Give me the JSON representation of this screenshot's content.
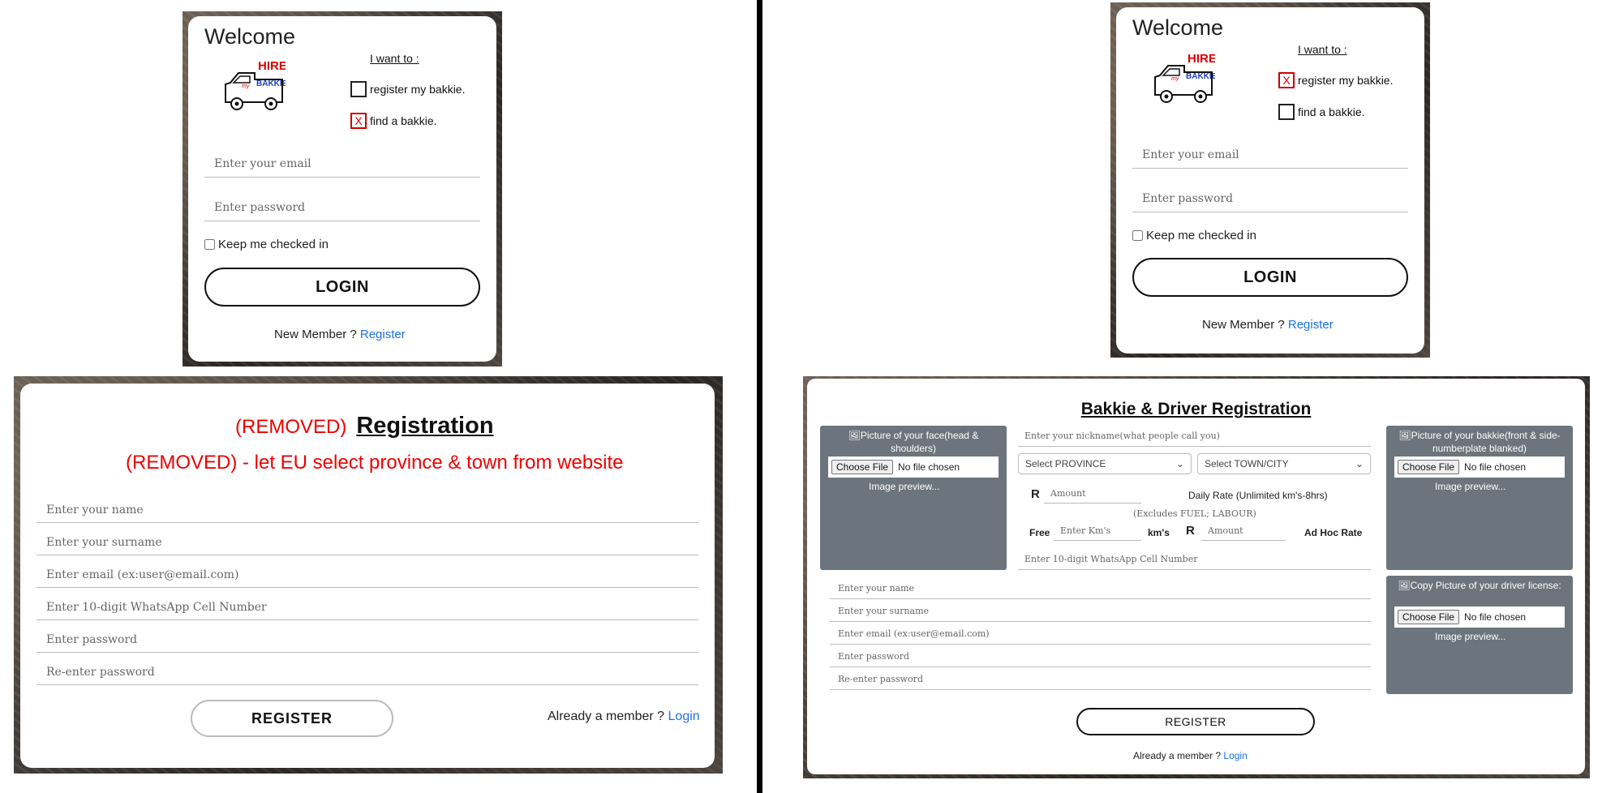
{
  "left": {
    "login": {
      "welcome": "Welcome",
      "i_want_to": "I want to :",
      "option_register": "register my bakkie.",
      "option_find": "find a bakkie.",
      "option_register_mark": "",
      "option_find_mark": "X",
      "email_placeholder": "Enter your email",
      "password_placeholder": "Enter password",
      "keep_checked": "Keep me checked in",
      "login_button": "LOGIN",
      "new_member": "New Member ?",
      "register_link": "Register"
    },
    "registration": {
      "removed_prefix": "(REMOVED)",
      "title": "Registration",
      "removed_note": "(REMOVED) - let EU select province & town from website",
      "fields": [
        "Enter your name",
        "Enter your surname",
        "Enter email (ex:user@email.com)",
        "Enter 10-digit WhatsApp Cell Number",
        "Enter password",
        "Re-enter password"
      ],
      "register_button": "REGISTER",
      "already_member": "Already a member ?",
      "login_link": "Login"
    }
  },
  "right": {
    "login": {
      "welcome": "Welcome",
      "i_want_to": "I want to :",
      "option_register": "register my bakkie.",
      "option_find": "find a bakkie.",
      "option_register_mark": "X",
      "option_find_mark": "",
      "email_placeholder": "Enter your email",
      "password_placeholder": "Enter password",
      "keep_checked": "Keep me checked in",
      "login_button": "LOGIN",
      "new_member": "New Member ?",
      "register_link": "Register"
    },
    "registration": {
      "title": "Bakkie & Driver Registration",
      "face_label": "Picture of your face(head & shoulders)",
      "bakkie_label": "Picture of your bakkie(front & side-numberplate blanked)",
      "license_label": "Copy Picture of your driver license:",
      "choose_file": "Choose File",
      "no_file": "No file chosen",
      "image_preview": "Image preview...",
      "nickname_placeholder": "Enter your nickname(what people call you)",
      "province_select": "Select PROVINCE",
      "town_select": "Select TOWN/CITY",
      "rand": "R",
      "amount_placeholder": "Amount",
      "daily_rate": "Daily Rate (Unlimited km's-8hrs)",
      "excludes": "(Excludes FUEL; LABOUR)",
      "free": "Free",
      "km_placeholder": "Enter Km's",
      "kms": "km's",
      "adhoc": "Ad Hoc Rate",
      "whatsapp_placeholder": "Enter 10-digit WhatsApp Cell Number",
      "fields": [
        "Enter your name",
        "Enter your surname",
        "Enter email (ex:user@email.com)",
        "Enter password",
        "Re-enter password"
      ],
      "register_button": "REGISTER",
      "already_member": "Already a member ?",
      "login_link": "Login"
    }
  },
  "logo_text": {
    "hire": "HIRE",
    "my": "my",
    "bakkie": "BAKKIE"
  },
  "colors": {
    "link": "#1a73e8",
    "removed": "#e00000",
    "panel": "#6c757d"
  }
}
